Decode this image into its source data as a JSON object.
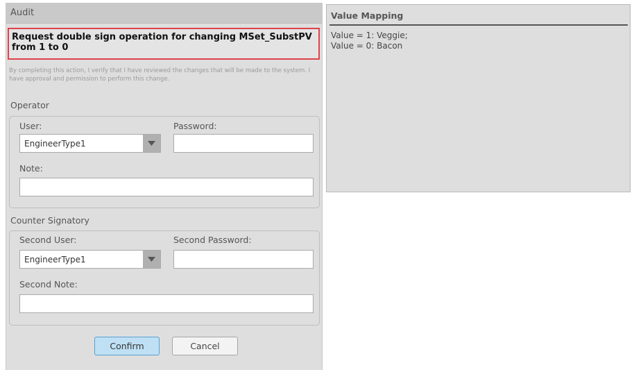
{
  "audit": {
    "header_title": "Audit",
    "request_text": "Request double sign operation for changing MSet_SubstPV from 1 to 0",
    "disclaimer": "By completing this action, I verify that I have reviewed the changes that will be made to the system. I have approval and permission to perform this change."
  },
  "operator": {
    "section_title": "Operator",
    "user_label": "User:",
    "user_value": "EngineerType1",
    "password_label": "Password:",
    "password_value": "",
    "note_label": "Note:",
    "note_value": ""
  },
  "counter": {
    "section_title": "Counter Signatory",
    "user_label": "Second User:",
    "user_value": "EngineerType1",
    "password_label": "Second Password:",
    "password_value": "",
    "note_label": "Second Note:",
    "note_value": ""
  },
  "buttons": {
    "confirm_label": "Confirm",
    "cancel_label": "Cancel"
  },
  "value_mapping": {
    "title": "Value Mapping",
    "lines": [
      "Value = 1: Veggie;",
      "Value = 0: Bacon"
    ]
  },
  "colors": {
    "highlight_border": "#e0424a",
    "confirm_border": "#5a9fd1",
    "confirm_fill": "#bfe0f4"
  },
  "icons": {
    "dropdown": "chevron-down-icon"
  }
}
